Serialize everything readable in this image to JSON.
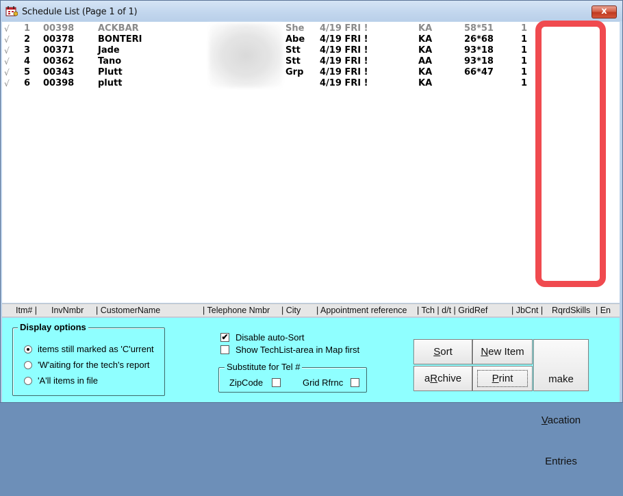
{
  "window": {
    "title": "Schedule List (Page 1 of 1)",
    "close_glyph": "x"
  },
  "rows": [
    {
      "mark": "√",
      "itm": "1",
      "inv": "00398",
      "customer": "ACKBAR",
      "city": "She",
      "appt": "4/19 FRI !",
      "tch": "KA",
      "grid": "58*51",
      "jb": "1",
      "gray": true
    },
    {
      "mark": "√",
      "itm": "2",
      "inv": "00378",
      "customer": "BONTERI",
      "city": "Abe",
      "appt": "4/19 FRI !",
      "tch": "KA",
      "grid": "26*68",
      "jb": "1",
      "gray": false
    },
    {
      "mark": "√",
      "itm": "3",
      "inv": "00371",
      "customer": "Jade",
      "city": "Stt",
      "appt": "4/19 FRI !",
      "tch": "KA",
      "grid": "93*18",
      "jb": "1",
      "gray": false
    },
    {
      "mark": "√",
      "itm": "4",
      "inv": "00362",
      "customer": "Tano",
      "city": "Stt",
      "appt": "4/19 FRI !",
      "tch": "AA",
      "grid": "93*18",
      "jb": "1",
      "gray": false
    },
    {
      "mark": "√",
      "itm": "5",
      "inv": "00343",
      "customer": "Plutt",
      "city": "Grp",
      "appt": "4/19 FRI !",
      "tch": "KA",
      "grid": "66*47",
      "jb": "1",
      "gray": false
    },
    {
      "mark": "√",
      "itm": "6",
      "inv": "00398",
      "customer": "plutt",
      "city": "",
      "appt": "4/19 FRI !",
      "tch": "KA",
      "grid": "",
      "jb": "1",
      "gray": false
    }
  ],
  "columns": {
    "itm": "Itm# |",
    "inv": "InvNmbr",
    "customer": "| CustomerName",
    "telephone": "| Telephone Nmbr",
    "city": "| City",
    "appt": "| Appointment reference",
    "tch": "| Tch | d/t | GridRef",
    "jb": "| JbCnt |",
    "skills": "RqrdSkills",
    "extra": "| En"
  },
  "display_options": {
    "title": "Display options",
    "options": [
      {
        "label": "items still marked as 'C'urrent",
        "selected": true
      },
      {
        "label": "'W'aiting for the tech's report",
        "selected": false
      },
      {
        "label": "'A'll items in file",
        "selected": false
      }
    ]
  },
  "checks": {
    "disable_autosort": {
      "label": "Disable auto-Sort",
      "checked": true
    },
    "show_techlist": {
      "label": "Show TechList-area in Map first",
      "checked": false
    }
  },
  "substitute": {
    "title": "Substitute for Tel #",
    "zipcode_label": "ZipCode",
    "grid_label": "Grid Rfrnc"
  },
  "buttons": {
    "sort_u": "S",
    "sort_rest": "ort",
    "newitem_u": "N",
    "newitem_rest": "ew Item",
    "make_line1": "make",
    "make_u": "V",
    "make_line2_rest": "acation",
    "make_line3": "Entries",
    "archive_pre": "a",
    "archive_u": "R",
    "archive_rest": "chive",
    "print_u": "P",
    "print_rest": "rint"
  },
  "colors": {
    "panel": "#8fffff",
    "highlight": "#f04a4f"
  }
}
